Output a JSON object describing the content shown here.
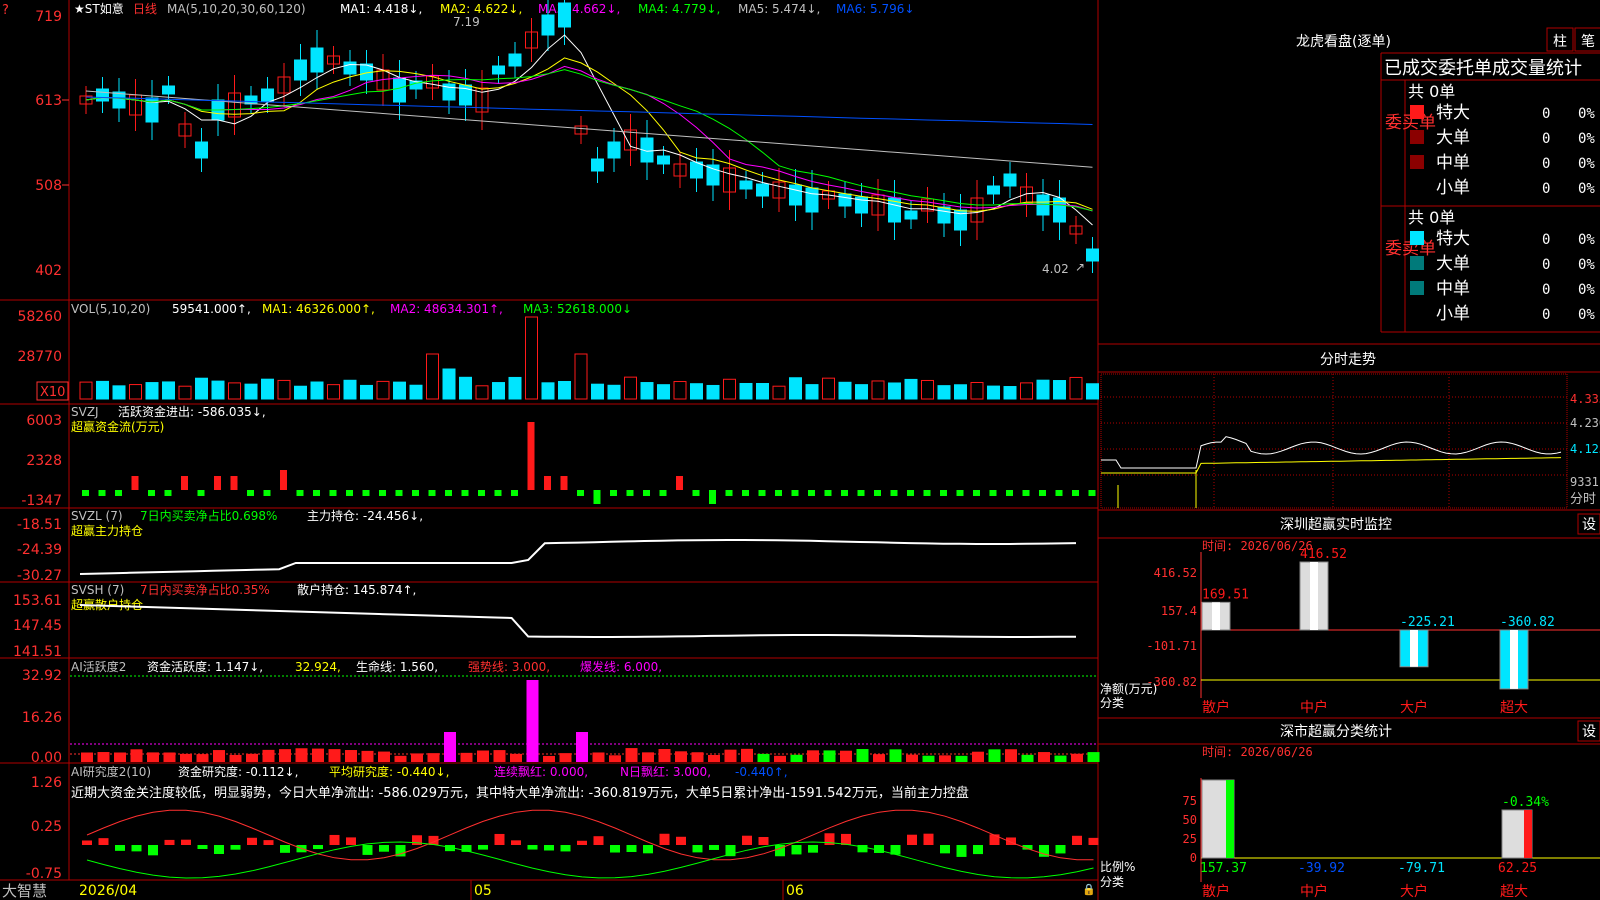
{
  "colors": {
    "bg": "#000000",
    "border": "#b00000",
    "up": "#ff1a1a",
    "down": "#00e5ff",
    "green": "#00ff00",
    "yellow": "#ffff00",
    "magenta": "#ff00ff",
    "white": "#ffffff",
    "gray": "#c0c0c0",
    "blue": "#0050ff",
    "darkred": "#8b0000",
    "teal": "#007a7a"
  },
  "main": {
    "title_star": "★ST如意",
    "period": "日线",
    "ma_def": "MA(5,10,20,30,60,120)",
    "ma1": "MA1: 4.418↓,",
    "ma2": "MA2: 4.622↓,",
    "ma3": "MA3: 4.662↓,",
    "ma4": "MA4: 4.779↓,",
    "ma5": "MA5: 5.474↓,",
    "ma6": "MA6: 5.796↓",
    "y_labels": [
      "719",
      "613",
      "508",
      "402"
    ],
    "high_label": "7.19",
    "low_label": "4.02"
  },
  "vol": {
    "def": "VOL(5,10,20)",
    "val": "59541.000↑,",
    "ma1": "MA1: 46326.000↑,",
    "ma2": "MA2: 48634.301↑,",
    "ma3": "MA3: 52618.000↓",
    "y_labels": [
      "58260",
      "28770"
    ],
    "unit": "X10"
  },
  "svzj": {
    "def": "SVZJ",
    "line1": "活跃资金进出: -586.035↓,",
    "line2": "超赢资金流(万元)",
    "y_labels": [
      "6003",
      "2328",
      "-1347"
    ]
  },
  "svzl": {
    "def": "SVZL (7)",
    "pct": "7日内买卖净占比0.698%",
    "hold": "主力持仓: -24.456↓,",
    "line2": "超赢主力持仓",
    "y_labels": [
      "-18.51",
      "-24.39",
      "-30.27"
    ]
  },
  "svsh": {
    "def": "SVSH (7)",
    "pct": "7日内买卖净占比0.35%",
    "hold": "散户持仓: 145.874↑,",
    "line2": "超赢散户持仓",
    "y_labels": [
      "153.61",
      "147.45",
      "141.51"
    ]
  },
  "aihy": {
    "def": "AI活跃度2",
    "l1": "资金活跃度: 1.147↓,",
    "l2": "32.924,",
    "l3": "生命线: 1.560,",
    "l4": "强势线: 3.000,",
    "l5": "爆发线: 6.000,",
    "y_labels": [
      "32.92",
      "16.26",
      "0.00"
    ]
  },
  "aiyj": {
    "def": "AI研究度2(10)",
    "l1": "资金研究度: -0.112↓,",
    "l2": "平均研究度: -0.440↓,",
    "l3": "连续飘红: 0.000,",
    "l4": "N日飘红: 3.000,",
    "l5": "-0.440↑,",
    "comment": "近期大资金关注度较低，明显弱势，今日大单净流出: -586.029万元，其中特大单净流出: -360.819万元，大单5日累计净出-1591.542万元，当前主力控盘",
    "y_labels": [
      "1.26",
      "0.25",
      "-0.75"
    ]
  },
  "xaxis": {
    "brand": "大智慧",
    "d1": "2026/04",
    "d2": "05",
    "d3": "06"
  },
  "lhb": {
    "title": "龙虎看盘(逐单)",
    "btn1": "柱",
    "btn2": "笔",
    "heading": "已成交委托单成交量统计",
    "buy_label": "委买单",
    "sell_label": "委卖单",
    "total": "共 0单",
    "rows": [
      {
        "name": "特大",
        "count": "0",
        "pct": "0%"
      },
      {
        "name": "大单",
        "count": "0",
        "pct": "0%"
      },
      {
        "name": "中单",
        "count": "0",
        "pct": "0%"
      },
      {
        "name": "小单",
        "count": "0",
        "pct": "0%"
      }
    ]
  },
  "intraday": {
    "title": "分时走势",
    "p1": "4.335",
    "p2": "4.230",
    "p3": "4.125",
    "vol": "9331",
    "unit": "分时"
  },
  "sz_monitor": {
    "title": "深圳超赢实时监控",
    "btn": "设",
    "time": "时间: 2026/06/26",
    "y_labels": [
      "416.52",
      "157.4",
      "-101.71",
      "-360.82"
    ],
    "axis1": "净额(万元)",
    "axis2": "分类",
    "cats": [
      "散户",
      "中户",
      "大户",
      "超大"
    ],
    "values": [
      "169.51",
      "416.52",
      "-225.21",
      "-360.82"
    ]
  },
  "sz_class": {
    "title": "深市超赢分类统计",
    "btn": "设",
    "time": "时间: 2026/06/26",
    "y_labels": [
      "75",
      "50",
      "25",
      "0"
    ],
    "axis1": "比例%",
    "axis2": "分类",
    "cats": [
      "散户",
      "中户",
      "大户",
      "超大"
    ],
    "values": [
      "157.37",
      "-39.92",
      "-79.71",
      "62.25"
    ],
    "top_label": "-0.34%"
  }
}
